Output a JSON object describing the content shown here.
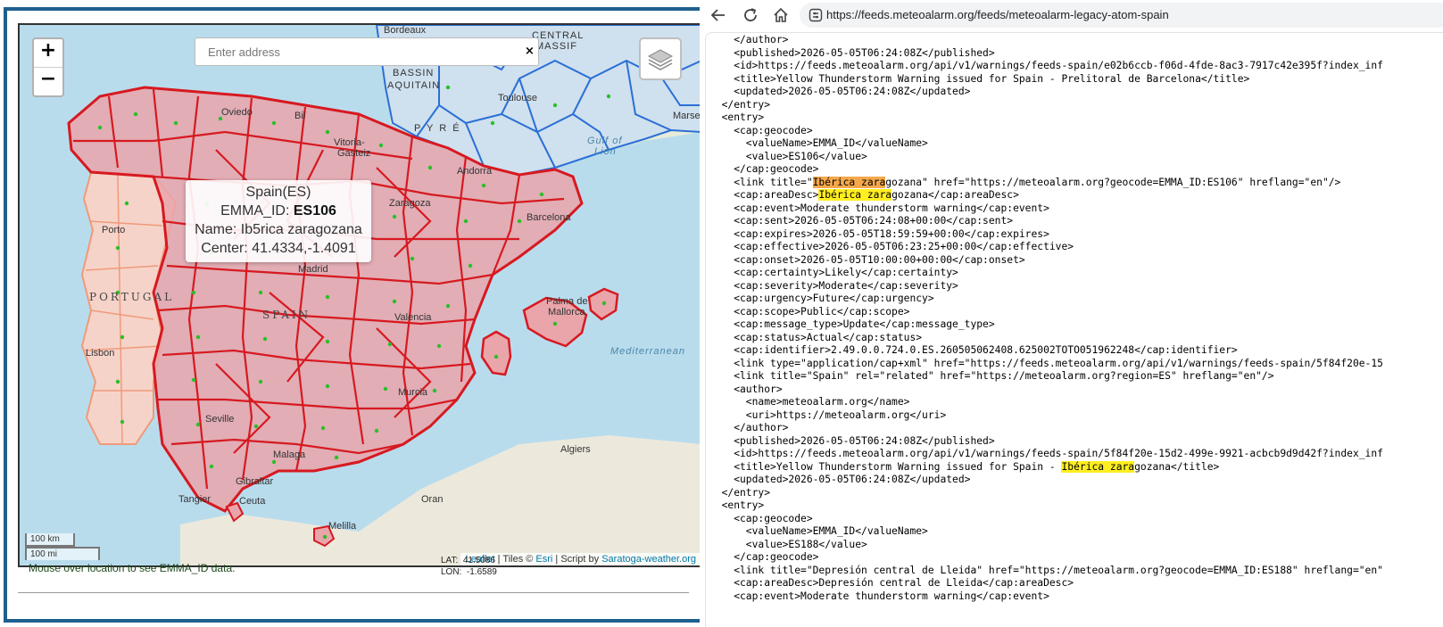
{
  "map": {
    "zoom_in": "+",
    "zoom_out": "−",
    "address_placeholder": "Enter address",
    "address_clear": "×",
    "layers_icon": "layers-icon",
    "popup": {
      "line1": "Spain(ES)",
      "line2_prefix": "EMMA_ID: ",
      "line2_value": "ES106",
      "line3": "Name: Ib5rica zaragozana",
      "line4": "Center: 41.4334,-1.4091"
    },
    "labels": {
      "bordeaux": "Bordeaux",
      "bassin": "BASSIN",
      "aquitain": "AQUITAIN",
      "central": "CENTRAL",
      "massif": "MASSIF",
      "toulouse": "Toulouse",
      "marseille": "Marsei",
      "pyre": "P Y R É",
      "gulf": "Gulf of",
      "lion": "Lion",
      "bilbao": "Bil",
      "oviedo": "Oviedo",
      "vitoria1": "Vitoria-",
      "vitoria2": "Gasteiz",
      "andorra": "Andorra",
      "zaragoza": "Zaragoza",
      "barcelona": "Barcelona",
      "porto": "Porto",
      "portugal": "PORTUGAL",
      "madrid": "Madrid",
      "spain": "SPAIN",
      "valencia": "Valencia",
      "palma1": "Palma de",
      "palma2": "Mallorca",
      "mediterranean": "Mediterranean",
      "lisbon": "Lisbon",
      "murcia": "Murcia",
      "seville": "Seville",
      "malaga": "Malaga",
      "gibraltar": "Gibraltar",
      "tangier": "Tangier",
      "ceuta": "Ceuta",
      "melilla": "Melilla",
      "oran": "Oran",
      "algiers": "Algiers"
    },
    "scale_km": "100 km",
    "scale_mi": "100 mi",
    "attribution": {
      "leaflet": "Leaflet",
      "tiles": " | Tiles © ",
      "esri": "Esri",
      "script": " | Script by ",
      "saratoga": "Saratoga-weather.org"
    }
  },
  "status_text": "Mouse over location to see EMMA_ID data.",
  "coords": {
    "lat_label": "LAT:",
    "lat_value": "41.5086",
    "lon_label": "LON:",
    "lon_value": "-1.6589"
  },
  "browser": {
    "back_icon": "back-arrow-icon",
    "reload_icon": "reload-icon",
    "home_icon": "home-icon",
    "site_info_icon": "site-info-icon",
    "url": "https://feeds.meteoalarm.org/feeds/meteoalarm-legacy-atom-spain"
  },
  "xml_lines": [
    [
      "    </author>"
    ],
    [
      "    <published>2026-05-05T06:24:08Z</published>"
    ],
    [
      "    <id>https://feeds.meteoalarm.org/api/v1/warnings/feeds-spain/e02b6ccb-f06d-4fde-8ac3-7917c42e395f?index_inf"
    ],
    [
      "    <title>Yellow Thunderstorm Warning issued for Spain - Prelitoral de Barcelona</title>"
    ],
    [
      "    <updated>2026-05-05T06:24:08Z</updated>"
    ],
    [
      "  </entry>"
    ],
    [
      "  <entry>"
    ],
    [
      "    <cap:geocode>"
    ],
    [
      "      <valueName>EMMA_ID</valueName>"
    ],
    [
      "      <value>ES106</value>"
    ],
    [
      "    </cap:geocode>"
    ],
    [
      "    <link title=\"",
      {
        "h": "o",
        "t": "Ibérica zara"
      },
      "gozana\" href=\"https://meteoalarm.org?geocode=EMMA_ID:ES106\" hreflang=\"en\"/>"
    ],
    [
      "    <cap:areaDesc>",
      {
        "h": "y",
        "t": "Ibérica zara"
      },
      "gozana</cap:areaDesc>"
    ],
    [
      "    <cap:event>Moderate thunderstorm warning</cap:event>"
    ],
    [
      "    <cap:sent>2026-05-05T06:24:08+00:00</cap:sent>"
    ],
    [
      "    <cap:expires>2026-05-05T18:59:59+00:00</cap:expires>"
    ],
    [
      "    <cap:effective>2026-05-05T06:23:25+00:00</cap:effective>"
    ],
    [
      "    <cap:onset>2026-05-05T10:00:00+00:00</cap:onset>"
    ],
    [
      "    <cap:certainty>Likely</cap:certainty>"
    ],
    [
      "    <cap:severity>Moderate</cap:severity>"
    ],
    [
      "    <cap:urgency>Future</cap:urgency>"
    ],
    [
      "    <cap:scope>Public</cap:scope>"
    ],
    [
      "    <cap:message_type>Update</cap:message_type>"
    ],
    [
      "    <cap:status>Actual</cap:status>"
    ],
    [
      "    <cap:identifier>2.49.0.0.724.0.ES.260505062408.625002TOTO051962248</cap:identifier>"
    ],
    [
      "    <link type=\"application/cap+xml\" href=\"https://feeds.meteoalarm.org/api/v1/warnings/feeds-spain/5f84f20e-15"
    ],
    [
      "    <link title=\"Spain\" rel=\"related\" href=\"https://meteoalarm.org?region=ES\" hreflang=\"en\"/>"
    ],
    [
      "    <author>"
    ],
    [
      "      <name>meteoalarm.org</name>"
    ],
    [
      "      <uri>https://meteoalarm.org</uri>"
    ],
    [
      "    </author>"
    ],
    [
      "    <published>2026-05-05T06:24:08Z</published>"
    ],
    [
      "    <id>https://feeds.meteoalarm.org/api/v1/warnings/feeds-spain/5f84f20e-15d2-499e-9921-acbcb9d9d42f?index_inf"
    ],
    [
      "    <title>Yellow Thunderstorm Warning issued for Spain - ",
      {
        "h": "y",
        "t": "Ibérica zara"
      },
      "gozana</title>"
    ],
    [
      "    <updated>2026-05-05T06:24:08Z</updated>"
    ],
    [
      "  </entry>"
    ],
    [
      "  <entry>"
    ],
    [
      "    <cap:geocode>"
    ],
    [
      "      <valueName>EMMA_ID</valueName>"
    ],
    [
      "      <value>ES188</value>"
    ],
    [
      "    </cap:geocode>"
    ],
    [
      "    <link title=\"Depresión central de Lleida\" href=\"https://meteoalarm.org?geocode=EMMA_ID:ES188\" hreflang=\"en\""
    ],
    [
      "    <cap:areaDesc>Depresión central de Lleida</cap:areaDesc>"
    ],
    [
      "    <cap:event>Moderate thunderstorm warning</cap:event>"
    ]
  ],
  "colors": {
    "panel_border": "#1e5f8e",
    "sea": "#b9dced",
    "warning_fill": "#e8a3a8",
    "warning_stroke": "#d71920",
    "france_stroke": "#2a6fd6",
    "portugal_stroke": "#ef9a7a",
    "highlight_orange": "#f5a84b",
    "highlight_yellow": "#ffee20"
  }
}
